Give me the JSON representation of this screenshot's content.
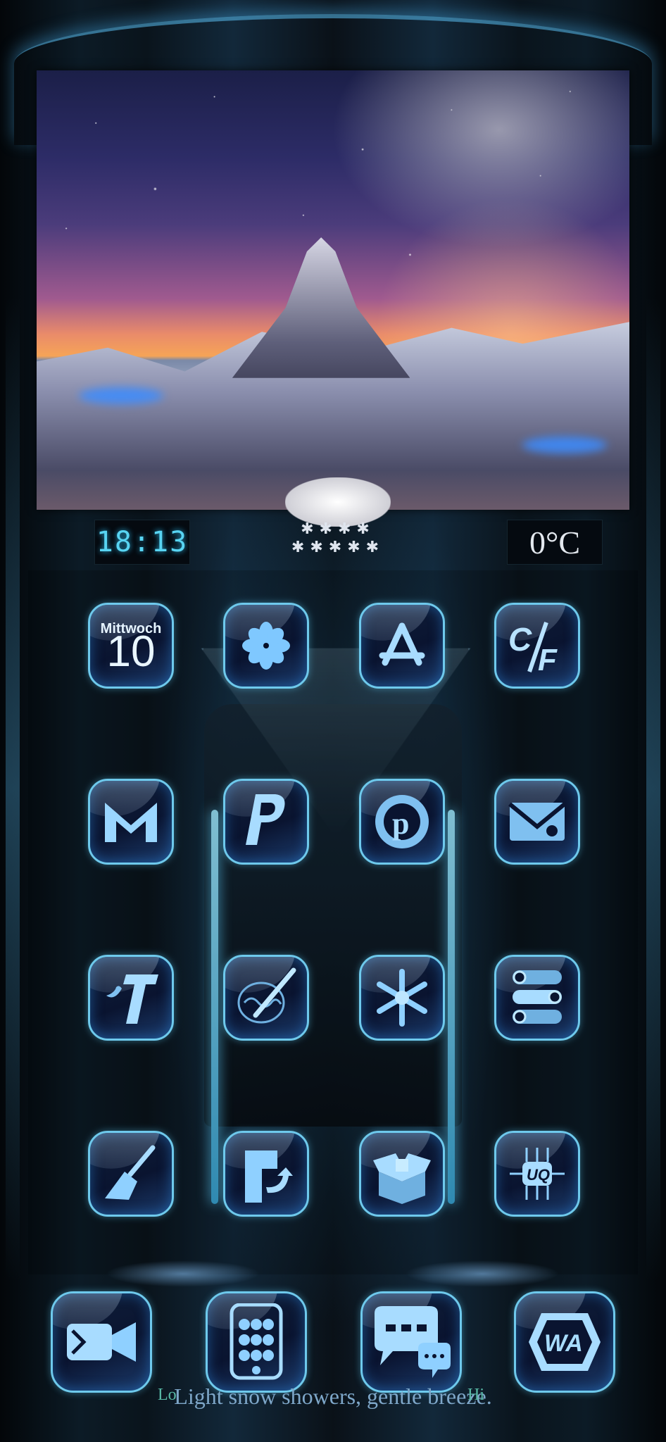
{
  "status": {
    "time": "18:13",
    "temperature": "0°C"
  },
  "weather": {
    "condition_icon": "snow-cloud-icon",
    "forecast": "Light snow showers, gentle breeze.",
    "lo_label": "Lo",
    "hi_label": "Hi"
  },
  "calendar": {
    "weekday": "Mittwoch",
    "day": "10"
  },
  "grid_icons": [
    [
      "calendar-icon",
      "pinwheel-icon",
      "app-store-icon",
      "celsius-fahrenheit-icon"
    ],
    [
      "gmail-icon",
      "paypal-icon",
      "pinterest-icon",
      "mail-icon"
    ],
    [
      "twitter-icon",
      "brain-pencil-icon",
      "snowflake-icon",
      "settings-toggles-icon"
    ],
    [
      "broom-icon",
      "reply-arrow-icon",
      "package-box-icon",
      "chip-icon"
    ]
  ],
  "dock_icons": [
    "video-camera-icon",
    "phone-keypad-icon",
    "chat-bubbles-icon",
    "whatsapp-icon"
  ],
  "colors": {
    "accent": "#6ec9ec",
    "clock": "#58d4f2",
    "hi_number": "#c8442c"
  }
}
